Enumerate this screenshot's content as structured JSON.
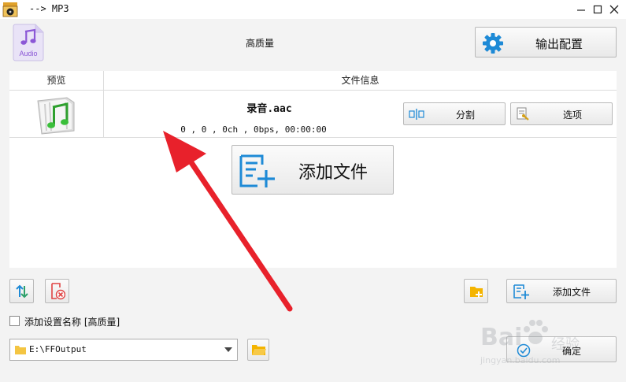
{
  "window": {
    "title": "--> MP3"
  },
  "header": {
    "quality": "高质量",
    "output_config_label": "输出配置",
    "audio_icon_label": "Audio"
  },
  "filelist": {
    "columns": [
      "预览",
      "文件信息"
    ],
    "rows": [
      {
        "name": "录音.aac",
        "meta": "0 , 0 , 0ch , 0bps, 00:00:00",
        "split_label": "分割",
        "options_label": "选项"
      }
    ]
  },
  "add_file_big_label": "添加文件",
  "bottom": {
    "add_file_label": "添加文件",
    "checkbox_label": "添加设置名称 [高质量]",
    "output_path": "E:\\FFOutput",
    "ok_label": "确定"
  },
  "watermark": {
    "line1": "Bai",
    "line2": "经验",
    "line3": "jingyan.baidu.com"
  },
  "colors": {
    "accent_blue": "#1e8ad6",
    "arrow_red": "#e8212b",
    "folder_yellow": "#f4b400"
  }
}
